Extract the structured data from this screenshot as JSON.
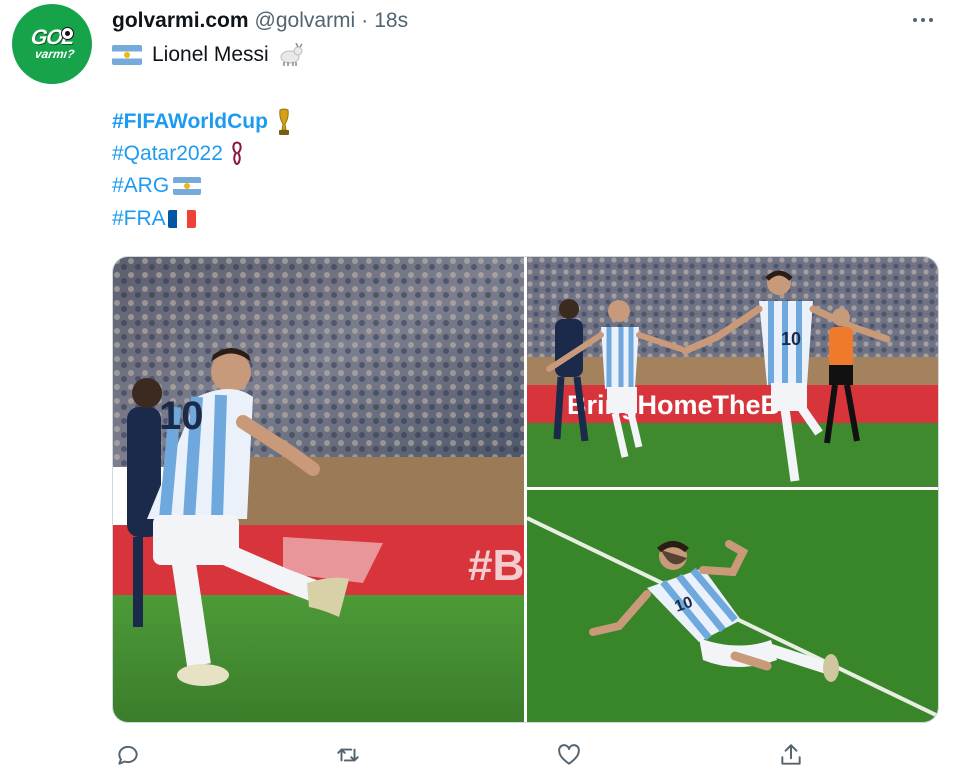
{
  "account": {
    "display_name": "golvarmi.com",
    "handle": "@golvarmi",
    "separator": "·",
    "time": "18s",
    "avatar_text_1": "GOL",
    "avatar_text_2": "varmı?"
  },
  "tweet": {
    "line1_text": "Lionel Messi",
    "line1_emoji": [
      "argentina-flag",
      "goat"
    ],
    "hashtags": [
      {
        "text": "#FIFAWorldCup",
        "emoji": "trophy",
        "bold": true
      },
      {
        "text": "#Qatar2022",
        "emoji": "qatar-2022-logo",
        "bold": false
      },
      {
        "text": "#ARG",
        "emoji": "argentina-flag",
        "bold": false
      },
      {
        "text": "#FRA",
        "emoji": "france-flag",
        "bold": false
      }
    ]
  },
  "media": {
    "photos": [
      {
        "description": "messi-penalty-kick"
      },
      {
        "description": "messi-celebrating-arms-out"
      },
      {
        "description": "messi-knee-slide-celebration"
      }
    ],
    "banner_text_1": "BringHomeTheB",
    "banner_text_2": "#B"
  },
  "actions": [
    "reply-icon",
    "retweet-icon",
    "like-icon",
    "share-icon"
  ],
  "colors": {
    "link": "#1d9bf0",
    "secondary_text": "#536471",
    "avatar_green": "#16a34a",
    "pitch_green": "#3f8a2e"
  }
}
